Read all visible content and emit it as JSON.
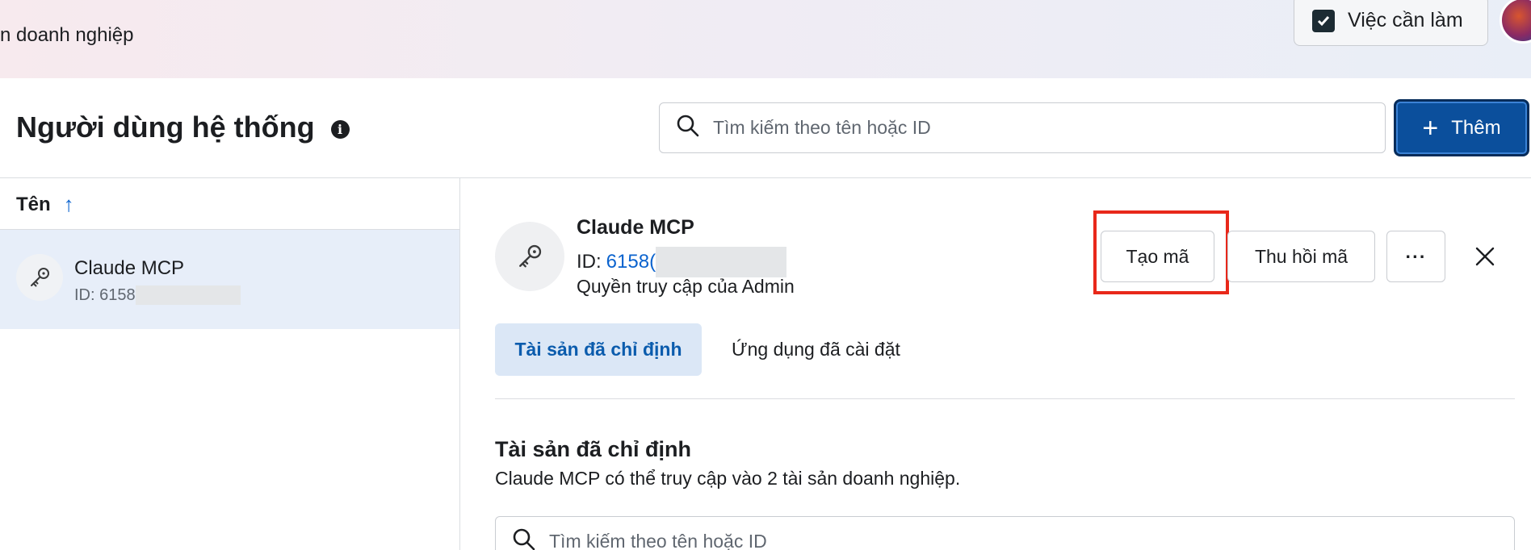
{
  "topbar": {
    "breadcrumb": "n doanh nghiệp",
    "todo_label": "Việc cần làm"
  },
  "header": {
    "title": "Người dùng hệ thống",
    "search_placeholder": "Tìm kiếm theo tên hoặc ID",
    "add_label": "Thêm"
  },
  "list": {
    "column_header": "Tên",
    "sort_direction": "ascending",
    "items": [
      {
        "name": "Claude MCP",
        "id_prefix": "ID: 6158"
      }
    ]
  },
  "detail": {
    "name": "Claude MCP",
    "id_label": "ID:",
    "id_value": "6158(",
    "access": "Quyền truy cập của Admin",
    "create_token_label": "Tạo mã",
    "revoke_token_label": "Thu hồi mã",
    "more_label": "···",
    "tabs": [
      {
        "label": "Tài sản đã chỉ định",
        "active": true
      },
      {
        "label": "Ứng dụng đã cài đặt",
        "active": false
      }
    ],
    "section_title": "Tài sản đã chỉ định",
    "section_desc": "Claude MCP có thể truy cập vào 2 tài sản doanh nghiệp.",
    "asset_search_placeholder": "Tìm kiếm theo tên hoặc ID"
  },
  "colors": {
    "accent": "#0b4f9c",
    "link": "#0b63ce",
    "highlight": "#e8281a",
    "selected_row": "#e7eef9"
  }
}
